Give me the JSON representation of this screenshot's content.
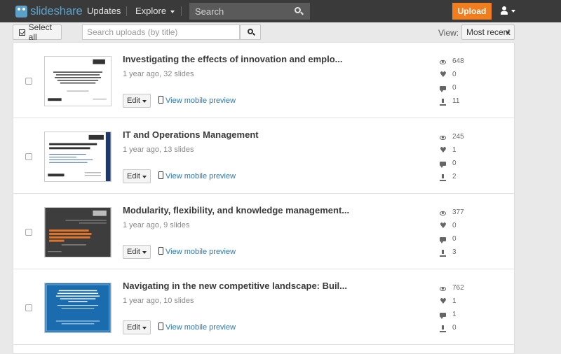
{
  "topbar": {
    "logo": "slideshare",
    "nav": [
      "Updates",
      "Explore"
    ],
    "search_placeholder": "Search",
    "upload": "Upload"
  },
  "toolbar": {
    "select_all": "Select all",
    "filter_placeholder": "Search uploads (by title)",
    "view_label": "View:",
    "sort": "Most recent"
  },
  "uploads": [
    {
      "title": "Investigating the effects of innovation and emplo...",
      "meta": "1 year ago, 32 slides",
      "views": "648",
      "likes": "0",
      "comments": "0",
      "downloads": "11",
      "edit": "Edit",
      "mobile": "View mobile preview",
      "theme": "white",
      "thumb_color": "#ffffff"
    },
    {
      "title": "IT and Operations Management",
      "meta": "1 year ago, 13 slides",
      "views": "245",
      "likes": "1",
      "comments": "0",
      "downloads": "2",
      "edit": "Edit",
      "mobile": "View mobile preview",
      "theme": "white-blue",
      "thumb_color": "#ffffff"
    },
    {
      "title": "Modularity, flexibility, and knowledge management...",
      "meta": "1 year ago, 9 slides",
      "views": "377",
      "likes": "0",
      "comments": "0",
      "downloads": "3",
      "edit": "Edit",
      "mobile": "View mobile preview",
      "theme": "dark",
      "thumb_color": "#3d3d3d"
    },
    {
      "title": "Navigating in the new competitive landscape: Buil...",
      "meta": "1 year ago, 10 slides",
      "views": "762",
      "likes": "1",
      "comments": "1",
      "downloads": "0",
      "edit": "Edit",
      "mobile": "View mobile preview",
      "theme": "blue",
      "thumb_color": "#1b6cae"
    }
  ],
  "colors": {
    "topbar": "#3a3a3a",
    "brand": "#5aa0c8",
    "upload": "#f07d1e",
    "link": "#2a7ab0"
  }
}
